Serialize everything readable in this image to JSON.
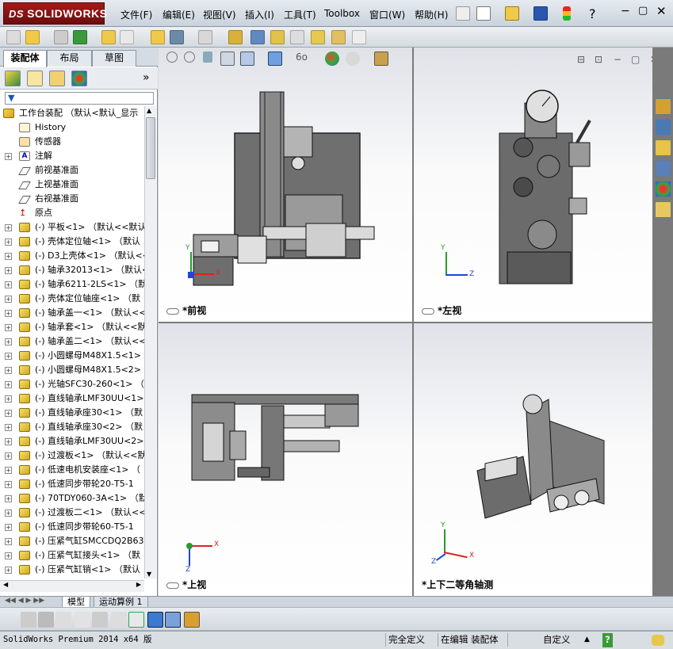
{
  "app": {
    "brand": "SOLIDWORKS",
    "brand_prefix": "DS"
  },
  "menu": [
    "文件(F)",
    "编辑(E)",
    "视图(V)",
    "插入(I)",
    "工具(T)",
    "Toolbox",
    "窗口(W)",
    "帮助(H)"
  ],
  "left_panel": {
    "tabs": [
      "装配体",
      "布局",
      "草图"
    ],
    "expand_label": "»",
    "tree_top": "工作台装配 （默认<默认_显示",
    "tree_fixed": [
      {
        "label": "History",
        "icon": "history-icon"
      },
      {
        "label": "传感器",
        "icon": "sensor-icon"
      },
      {
        "label": "注解",
        "icon": "annotation-icon"
      },
      {
        "label": "前视基准面",
        "icon": "plane-icon"
      },
      {
        "label": "上视基准面",
        "icon": "plane-icon"
      },
      {
        "label": "右视基准面",
        "icon": "plane-icon"
      },
      {
        "label": "原点",
        "icon": "origin-icon"
      }
    ],
    "tree_parts": [
      "(-) 平板<1> （默认<<默认",
      "(-) 壳体定位轴<1> （默认",
      "(-) D3上壳体<1> （默认<<",
      "(-) 轴承32013<1> （默认<",
      "(-) 轴承6211-2LS<1> （默",
      "(-) 壳体定位轴座<1> （默",
      "(-) 轴承盖一<1> （默认<<",
      "(-) 轴承套<1> （默认<<默",
      "(-) 轴承盖二<1> （默认<<",
      "(-) 小圆螺母M48X1.5<1>",
      "(-) 小圆螺母M48X1.5<2>",
      "(-) 光轴SFC30-260<1> （默",
      "(-) 直线轴承LMF30UU<1>",
      "(-) 直线轴承座30<1> （默",
      "(-) 直线轴承座30<2> （默",
      "(-) 直线轴承LMF30UU<2>",
      "(-) 过渡板<1> （默认<<默",
      "(-) 低速电机安装座<1> （",
      "(-) 低速同步带轮20-T5-1",
      "(-) 70TDY060-3A<1> （默认",
      "(-) 过渡板二<1> （默认<<",
      "(-) 低速同步带轮60-T5-1",
      "(-) 压紧气缸SMCCDQ2B63-",
      "(-) 压紧气缸接头<1> （默",
      "(-) 压紧气缸销<1> （默认"
    ]
  },
  "viewports": [
    {
      "label": "*前视",
      "axes": [
        "Y",
        "X"
      ]
    },
    {
      "label": "*左视",
      "axes": [
        "Y",
        "Z"
      ]
    },
    {
      "label": "*上视",
      "axes": [
        "X",
        "Z"
      ]
    },
    {
      "label": "*上下二等角轴测",
      "axes": [
        "Y",
        "X",
        "Z"
      ]
    }
  ],
  "bottom_tabs": [
    "模型",
    "运动算例 1"
  ],
  "status": {
    "version": "SolidWorks Premium 2014 x64 版",
    "defined": "完全定义",
    "editing": "在编辑 装配体",
    "units": "自定义",
    "help": "?"
  },
  "colors": {
    "accent": "#a61a1a",
    "panel_bg": "#d8d8d8",
    "viewport_top": "#dfe2e8"
  }
}
